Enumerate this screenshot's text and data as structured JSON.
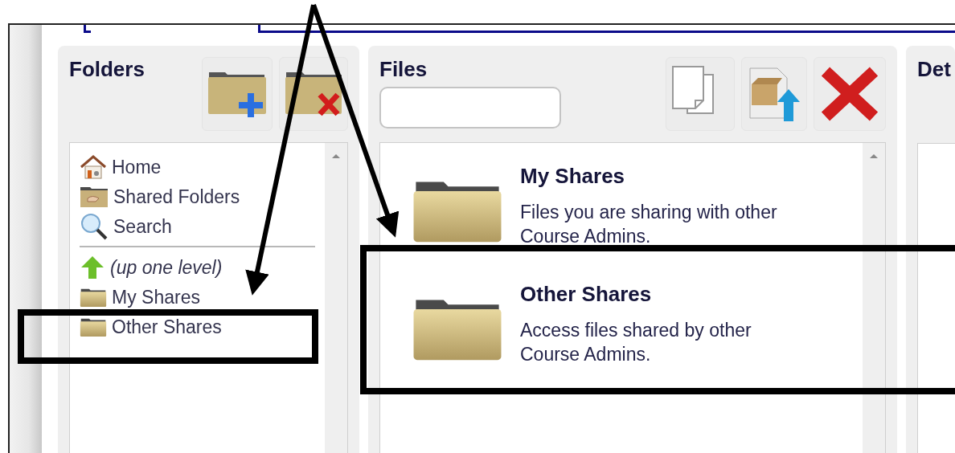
{
  "folders_panel": {
    "title": "Folders",
    "items": [
      {
        "kind": "home",
        "label": "Home"
      },
      {
        "kind": "shared",
        "label": "Shared Folders"
      },
      {
        "kind": "search",
        "label": "Search"
      },
      {
        "kind": "separator"
      },
      {
        "kind": "up",
        "label": "(up one level)"
      },
      {
        "kind": "folder",
        "label": "My Shares"
      },
      {
        "kind": "folder",
        "label": "Other Shares"
      }
    ]
  },
  "files_panel": {
    "title": "Files",
    "items": [
      {
        "title": "My Shares",
        "description": "Files you are sharing with other Course Admins."
      },
      {
        "title": "Other Shares",
        "description": "Access files shared by other Course Admins."
      }
    ]
  },
  "details_panel": {
    "title": "Det"
  }
}
